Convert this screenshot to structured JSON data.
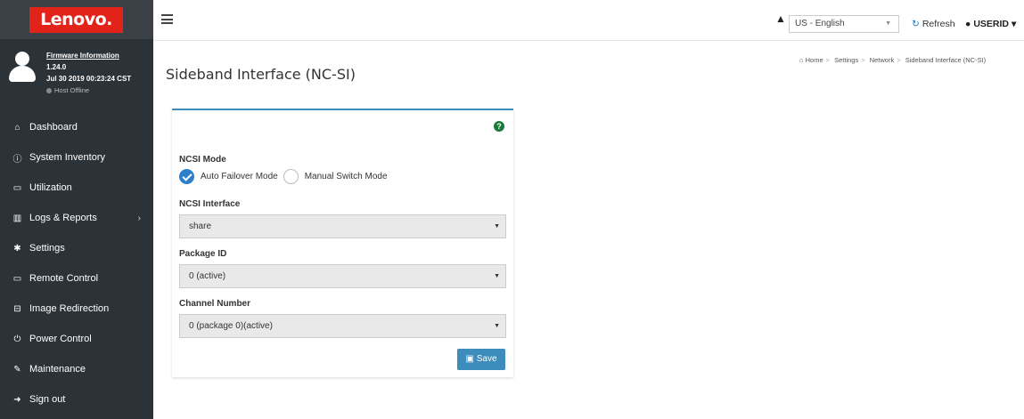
{
  "brand": {
    "logo_text": "Lenovo.",
    "logo_color": "#e2231a"
  },
  "user_panel": {
    "firmware_title": "Firmware Information",
    "version": "1.24.0",
    "build_date": "Jul 30 2019 00:23:24 CST",
    "host_status": "Host Offline"
  },
  "sidebar": {
    "items": [
      {
        "label": "Dashboard",
        "icon": "home-icon"
      },
      {
        "label": "System Inventory",
        "icon": "info-icon"
      },
      {
        "label": "Utilization",
        "icon": "laptop-icon"
      },
      {
        "label": "Logs & Reports",
        "icon": "bar-chart-icon"
      },
      {
        "label": "Settings",
        "icon": "gear-icon"
      },
      {
        "label": "Remote Control",
        "icon": "monitor-icon"
      },
      {
        "label": "Image Redirection",
        "icon": "drive-icon"
      },
      {
        "label": "Power Control",
        "icon": "power-icon"
      },
      {
        "label": "Maintenance",
        "icon": "wrench-icon"
      },
      {
        "label": "Sign out",
        "icon": "sign-out-icon"
      }
    ]
  },
  "header": {
    "language": "US - English",
    "refresh_label": "Refresh",
    "user_label": "USERID"
  },
  "page": {
    "title": "Sideband Interface (NC-SI)",
    "breadcrumb": [
      "Home",
      "Settings",
      "Network",
      "Sideband Interface (NC-SI)"
    ]
  },
  "form": {
    "ncsi_mode_label": "NCSI Mode",
    "mode_options": [
      {
        "label": "Auto Failover Mode",
        "checked": true
      },
      {
        "label": "Manual Switch Mode",
        "checked": false
      }
    ],
    "ncsi_interface_label": "NCSI Interface",
    "ncsi_interface_value": "share",
    "package_id_label": "Package ID",
    "package_id_value": "0 (active)",
    "channel_number_label": "Channel Number",
    "channel_number_value": "0 (package 0)(active)",
    "save_label": "Save"
  },
  "colors": {
    "sidebar_bg": "#2c3338",
    "accent": "#3c8dbc",
    "help": "#1a7a3a"
  }
}
